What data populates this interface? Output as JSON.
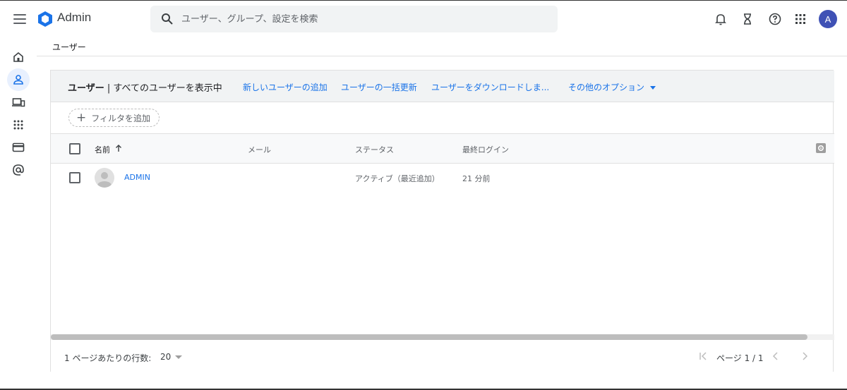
{
  "app": {
    "title": "Admin",
    "search_placeholder": "ユーザー、グループ、設定を検索",
    "avatar_initial": "A"
  },
  "topbar_icons": [
    "bell-icon",
    "hourglass-icon",
    "help-icon",
    "apps-grid-icon"
  ],
  "rail": {
    "items": [
      "home-icon",
      "user-icon",
      "devices-icon",
      "apps-icon",
      "billing-icon",
      "at-sign-icon"
    ],
    "active": "user-icon"
  },
  "breadcrumb": "ユーザー",
  "card": {
    "title_strong": "ユーザー",
    "title_rest": " | すべてのユーザーを表示中",
    "actions": {
      "add_user": "新しいユーザーの追加",
      "bulk_update": "ユーザーの一括更新",
      "download": "ユーザーをダウンロードしま...",
      "more_options": "その他のオプション"
    },
    "filter_label": "フィルタを追加"
  },
  "table": {
    "columns": {
      "name": "名前",
      "email": "メール",
      "status": "ステータス",
      "last_login": "最終ログイン"
    },
    "rows": [
      {
        "name": "ADMIN",
        "email": "",
        "status": "アクティブ（最近追加）",
        "last_login": "21 分前"
      }
    ]
  },
  "footer": {
    "rows_per_page_label": "1 ページあたりの行数:",
    "rows_per_page_value": "20",
    "page_label": "ページ 1 / 1"
  },
  "colors": {
    "accent": "#1a73e8",
    "avatar": "#3f51b5",
    "header_bg": "#f1f3f4"
  }
}
